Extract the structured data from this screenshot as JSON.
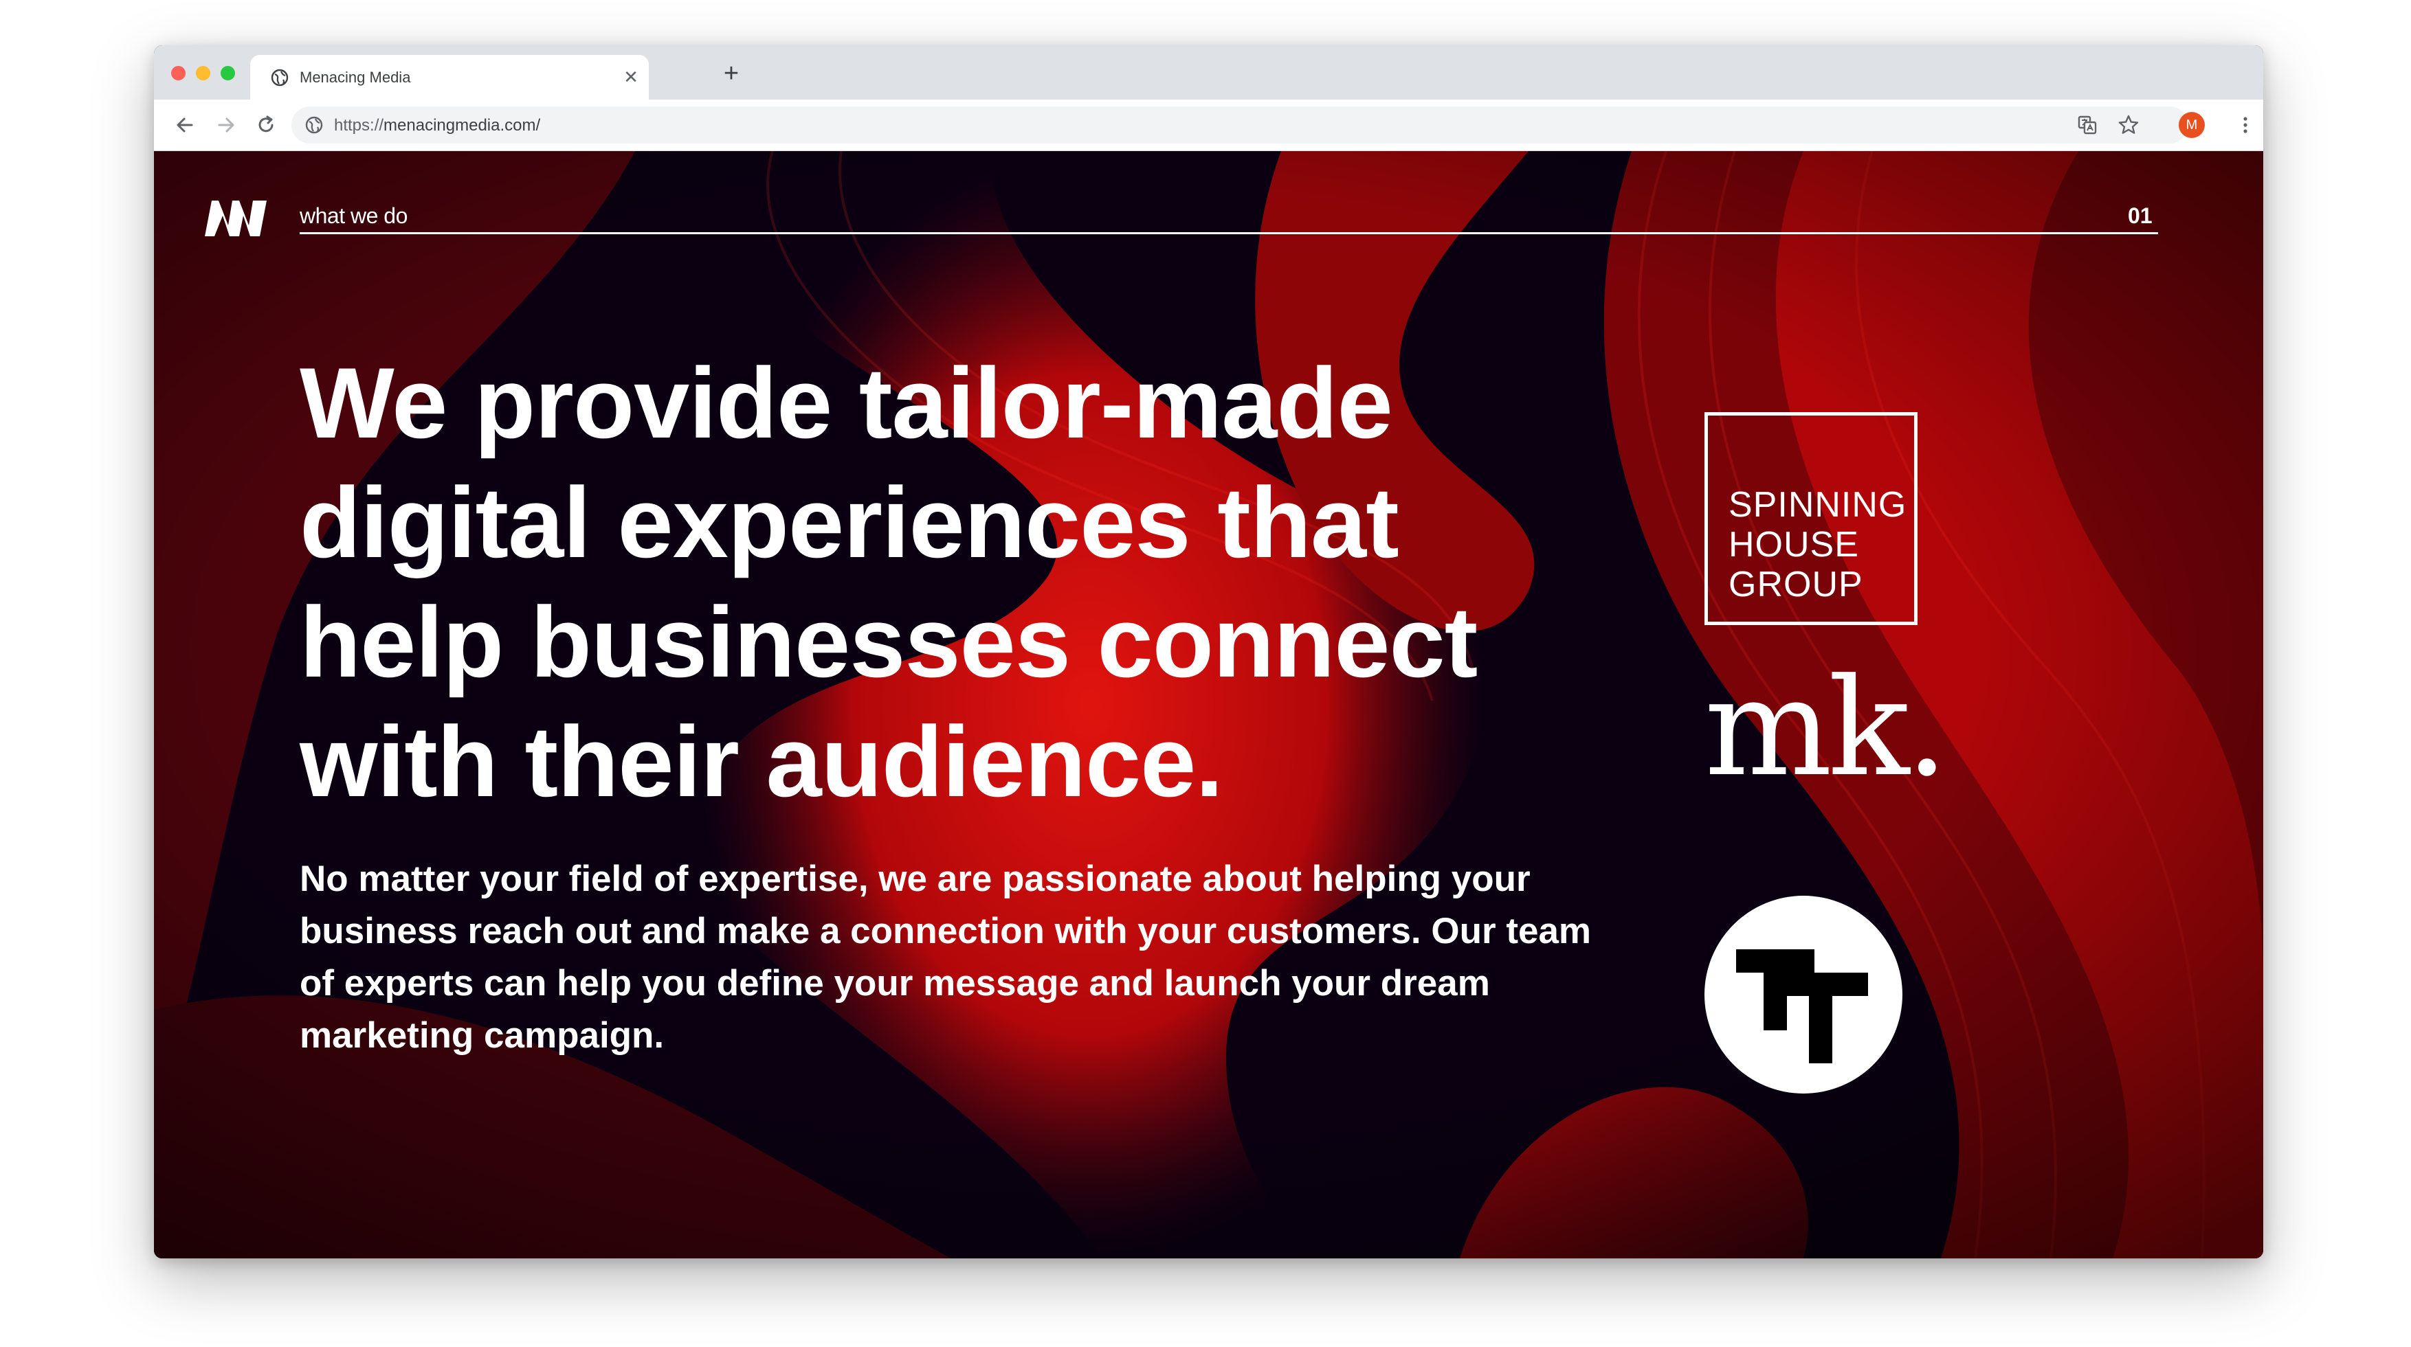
{
  "browser": {
    "tab": {
      "title": "Menacing Media"
    },
    "address": {
      "scheme": "https://",
      "host": "menacingmedia.com/"
    },
    "profile_initial": "M"
  },
  "page": {
    "section": {
      "label": "what we do",
      "number": "01"
    },
    "headline": "We provide tailor-made digital experiences that help businesses connect with their audience.",
    "body": "No matter your field of expertise, we are passionate about helping your business reach out and make a connection with your customers. Our team of experts can help you define your message and launch your dream marketing campaign.",
    "clients": [
      {
        "name": "spinning-house-group",
        "lines": [
          "SPINNING",
          "HOUSE",
          "GROUP"
        ]
      },
      {
        "name": "mk",
        "text": "mk."
      },
      {
        "name": "tt",
        "text": "TT"
      }
    ]
  },
  "icons": {
    "tab_favicon": "globe-icon",
    "tab_close": "close-icon",
    "new_tab": "plus-icon",
    "back": "arrow-left-icon",
    "forward": "arrow-right-icon",
    "reload": "reload-icon",
    "site_info": "globe-icon",
    "translate": "translate-icon",
    "bookmark": "star-icon",
    "menu": "kebab-menu-icon"
  },
  "colors": {
    "accent_red": "#c8090b",
    "background_dark": "#080010",
    "profile_avatar": "#e8501e",
    "chrome_tabstrip": "#dee1e6"
  }
}
